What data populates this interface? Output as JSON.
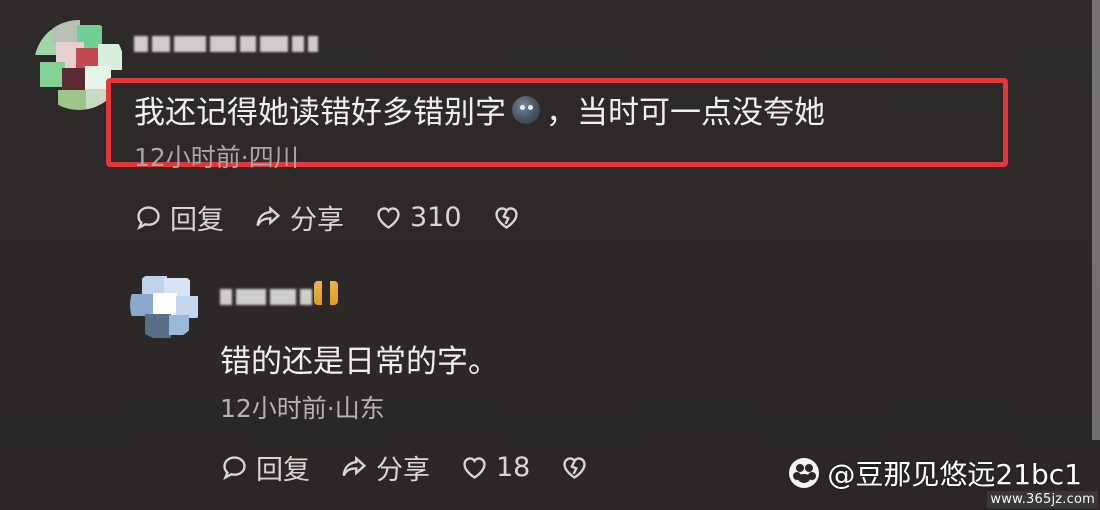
{
  "comments": {
    "main": {
      "text_before_emoji": "我还记得她读错好多错别字",
      "emoji": "dark-face-emoji",
      "text_after_emoji": "，当时可一点没夸她",
      "meta": "12小时前·四川",
      "actions": {
        "reply_label": "回复",
        "share_label": "分享",
        "like_count": "310"
      }
    },
    "reply": {
      "text": "错的还是日常的字。",
      "meta": "12小时前·山东",
      "actions": {
        "reply_label": "回复",
        "share_label": "分享",
        "like_count": "18"
      }
    }
  },
  "watermark": {
    "account": "@豆那见悠远21bc1",
    "site": "www.365jz.com"
  },
  "colors": {
    "background": "#2b2827",
    "highlight": "#e7363b",
    "text": "#f1efed",
    "meta": "#b6b2af"
  },
  "icons": {
    "comment": "comment-bubble-icon",
    "share": "share-arrow-icon",
    "like": "heart-icon",
    "dislike": "broken-heart-icon",
    "watermark": "paw-logo-icon"
  }
}
